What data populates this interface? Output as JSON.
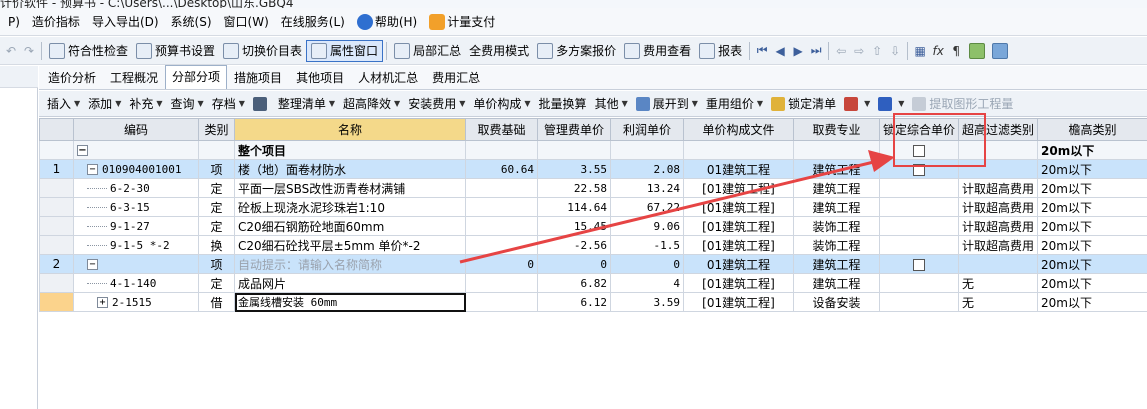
{
  "window": {
    "title_fragment": "计价软件 - 预算书 - C:\\Users\\...\\Desktop\\山东.GBQ4"
  },
  "menu": {
    "items": [
      {
        "label": "P)"
      },
      {
        "label": "造价指标"
      },
      {
        "label": "导入导出(D)"
      },
      {
        "label": "系统(S)"
      },
      {
        "label": "窗口(W)"
      },
      {
        "label": "在线服务(L)"
      },
      {
        "label": "帮助(H)"
      },
      {
        "label": "计量支付"
      }
    ]
  },
  "toolbar": {
    "conformity": "符合性检查",
    "budget_settings": "预算书设置",
    "switch_price": "切换价目表",
    "property_window": "属性窗口",
    "local_summary": "局部汇总",
    "full_mode": "全费用模式",
    "multi_quote": "多方案报价",
    "fee_check": "费用查看",
    "report": "报表",
    "glyph_undo": "↶",
    "glyph_redo": "↷",
    "glyph_first": "⏮",
    "glyph_prev": "◀",
    "glyph_next": "▶",
    "glyph_last": "⏭",
    "glyph_left": "⇦",
    "glyph_right": "⇨",
    "glyph_up": "⇧",
    "glyph_down": "⇩",
    "glyph_calc": "▦",
    "glyph_fx": "fx",
    "glyph_pilcrow": "¶"
  },
  "tabs": [
    {
      "label": "造价分析",
      "active": false
    },
    {
      "label": "工程概况",
      "active": false
    },
    {
      "label": "分部分项",
      "active": true
    },
    {
      "label": "措施项目",
      "active": false
    },
    {
      "label": "其他项目",
      "active": false
    },
    {
      "label": "人材机汇总",
      "active": false
    },
    {
      "label": "费用汇总",
      "active": false
    }
  ],
  "subtoolbar": {
    "insert": "插入",
    "add": "添加",
    "supplement": "补充",
    "query": "查询",
    "save": "存档",
    "organize": "整理清单",
    "super_reduce": "超高降效",
    "install_fee": "安装费用",
    "unit_comp": "单价构成",
    "batch_convert": "批量换算",
    "other": "其他",
    "expand": "展开到",
    "reuse_price": "重用组价",
    "lock_list": "锁定清单",
    "extract": "提取图形工程量"
  },
  "grid": {
    "columns": [
      "编码",
      "类别",
      "名称",
      "取费基础",
      "管理费单价",
      "利润单价",
      "单价构成文件",
      "取费专业",
      "锁定综合单价",
      "超高过滤类别",
      "檐高类别"
    ],
    "total_row": {
      "name": "整个项目",
      "eave": "20m以下"
    },
    "rows": [
      {
        "idx": "1",
        "code": "010904001001",
        "type": "项",
        "name": "楼（地）面卷材防水",
        "base": "60.64",
        "mgmt": "3.55",
        "profit": "2.08",
        "file": "01建筑工程",
        "major": "建筑工程",
        "filter": "",
        "eave": "20m以下"
      },
      {
        "idx": "",
        "code": "6-2-30",
        "type": "定",
        "name": "平面一层SBS改性沥青卷材满铺",
        "base": "",
        "mgmt": "22.58",
        "profit": "13.24",
        "file": "[01建筑工程]",
        "major": "建筑工程",
        "filter": "计取超高费用",
        "eave": "20m以下"
      },
      {
        "idx": "",
        "code": "6-3-15",
        "type": "定",
        "name": "砼板上现浇水泥珍珠岩1:10",
        "base": "",
        "mgmt": "114.64",
        "profit": "67.22",
        "file": "[01建筑工程]",
        "major": "建筑工程",
        "filter": "计取超高费用",
        "eave": "20m以下"
      },
      {
        "idx": "",
        "code": "9-1-27",
        "type": "定",
        "name": "C20细石钢筋砼地面60mm",
        "base": "",
        "mgmt": "15.45",
        "profit": "9.06",
        "file": "[01建筑工程]",
        "major": "装饰工程",
        "filter": "计取超高费用",
        "eave": "20m以下"
      },
      {
        "idx": "",
        "code": "9-1-5 *-2",
        "type": "换",
        "name": "C20细石砼找平层±5mm  单价*-2",
        "base": "",
        "mgmt": "-2.56",
        "profit": "-1.5",
        "file": "[01建筑工程]",
        "major": "装饰工程",
        "filter": "计取超高费用",
        "eave": "20m以下"
      },
      {
        "idx": "2",
        "code": "",
        "type": "项",
        "name": "自动提示：请输入名称简称",
        "base": "0",
        "mgmt": "0",
        "profit": "0",
        "file": "01建筑工程",
        "major": "建筑工程",
        "filter": "",
        "eave": "20m以下"
      },
      {
        "idx": "",
        "code": "4-1-140",
        "type": "定",
        "name": "成品网片",
        "base": "",
        "mgmt": "6.82",
        "profit": "4",
        "file": "[01建筑工程]",
        "major": "建筑工程",
        "filter": "无",
        "eave": "20m以下"
      },
      {
        "idx": "",
        "code": "2-1515",
        "type": "借",
        "name": "金属线槽安装 60mm",
        "base": "",
        "mgmt": "6.12",
        "profit": "3.59",
        "file": "[01建筑工程]",
        "major": "设备安装",
        "filter": "无",
        "eave": "20m以下"
      }
    ]
  },
  "colors": {
    "annotation": "#e64444",
    "selected_row": "#c9e3fb",
    "name_header": "#f4d98a"
  }
}
